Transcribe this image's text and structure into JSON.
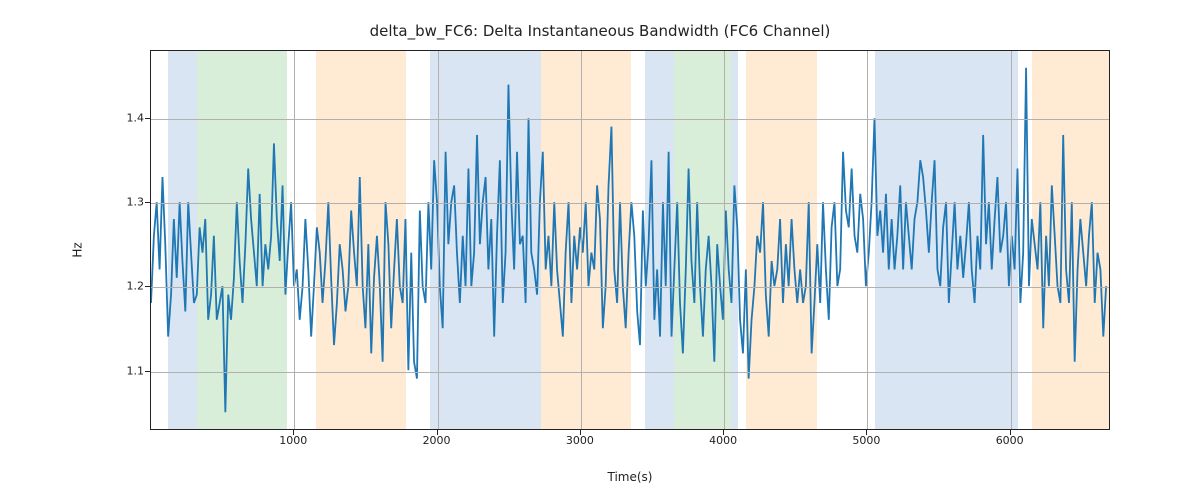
{
  "chart_data": {
    "type": "line",
    "title": "delta_bw_FC6: Delta Instantaneous Bandwidth (FC6 Channel)",
    "xlabel": "Time(s)",
    "ylabel": "Hz",
    "xlim": [
      0,
      6700
    ],
    "ylim": [
      1.03,
      1.48
    ],
    "xticks": [
      1000,
      2000,
      3000,
      4000,
      5000,
      6000
    ],
    "yticks": [
      1.1,
      1.2,
      1.3,
      1.4
    ],
    "bands": [
      {
        "x0": 120,
        "x1": 320,
        "color": "#6699cc"
      },
      {
        "x0": 320,
        "x1": 950,
        "color": "#66bb66"
      },
      {
        "x0": 1150,
        "x1": 1780,
        "color": "#ffaa55"
      },
      {
        "x0": 1950,
        "x1": 2100,
        "color": "#6699cc"
      },
      {
        "x0": 2100,
        "x1": 2720,
        "color": "#6699cc"
      },
      {
        "x0": 2720,
        "x1": 3350,
        "color": "#ffaa55"
      },
      {
        "x0": 3450,
        "x1": 3650,
        "color": "#6699cc"
      },
      {
        "x0": 3650,
        "x1": 4050,
        "color": "#66bb66"
      },
      {
        "x0": 4050,
        "x1": 4100,
        "color": "#6699cc"
      },
      {
        "x0": 4150,
        "x1": 4650,
        "color": "#ffaa55"
      },
      {
        "x0": 5050,
        "x1": 6050,
        "color": "#6699cc"
      },
      {
        "x0": 6150,
        "x1": 6700,
        "color": "#ffaa55"
      }
    ],
    "series": [
      {
        "name": "delta_bw_FC6",
        "x_step": 20,
        "x_start": 0,
        "values": [
          1.18,
          1.26,
          1.3,
          1.22,
          1.33,
          1.25,
          1.14,
          1.19,
          1.28,
          1.21,
          1.3,
          1.23,
          1.17,
          1.3,
          1.24,
          1.18,
          1.19,
          1.27,
          1.24,
          1.28,
          1.16,
          1.19,
          1.26,
          1.16,
          1.18,
          1.2,
          1.05,
          1.19,
          1.16,
          1.21,
          1.3,
          1.23,
          1.18,
          1.25,
          1.34,
          1.28,
          1.24,
          1.2,
          1.31,
          1.2,
          1.25,
          1.22,
          1.26,
          1.37,
          1.28,
          1.23,
          1.32,
          1.19,
          1.25,
          1.3,
          1.2,
          1.22,
          1.16,
          1.2,
          1.28,
          1.22,
          1.14,
          1.2,
          1.27,
          1.24,
          1.18,
          1.23,
          1.3,
          1.21,
          1.13,
          1.18,
          1.25,
          1.22,
          1.17,
          1.2,
          1.29,
          1.24,
          1.2,
          1.33,
          1.2,
          1.15,
          1.25,
          1.12,
          1.21,
          1.26,
          1.2,
          1.11,
          1.3,
          1.25,
          1.15,
          1.22,
          1.28,
          1.2,
          1.18,
          1.28,
          1.1,
          1.24,
          1.11,
          1.09,
          1.29,
          1.2,
          1.18,
          1.3,
          1.22,
          1.35,
          1.3,
          1.2,
          1.15,
          1.36,
          1.25,
          1.3,
          1.32,
          1.24,
          1.18,
          1.26,
          1.2,
          1.34,
          1.2,
          1.24,
          1.38,
          1.25,
          1.3,
          1.33,
          1.22,
          1.28,
          1.14,
          1.26,
          1.35,
          1.18,
          1.24,
          1.44,
          1.3,
          1.22,
          1.36,
          1.25,
          1.26,
          1.18,
          1.4,
          1.24,
          1.22,
          1.19,
          1.3,
          1.36,
          1.22,
          1.26,
          1.2,
          1.3,
          1.22,
          1.18,
          1.14,
          1.24,
          1.3,
          1.18,
          1.26,
          1.22,
          1.27,
          1.24,
          1.3,
          1.2,
          1.24,
          1.22,
          1.32,
          1.28,
          1.15,
          1.2,
          1.32,
          1.39,
          1.22,
          1.18,
          1.3,
          1.2,
          1.15,
          1.24,
          1.3,
          1.26,
          1.17,
          1.13,
          1.29,
          1.2,
          1.25,
          1.35,
          1.16,
          1.22,
          1.14,
          1.3,
          1.2,
          1.36,
          1.14,
          1.22,
          1.3,
          1.18,
          1.12,
          1.22,
          1.34,
          1.23,
          1.18,
          1.3,
          1.2,
          1.14,
          1.22,
          1.26,
          1.2,
          1.11,
          1.25,
          1.2,
          1.16,
          1.29,
          1.22,
          1.18,
          1.32,
          1.27,
          1.16,
          1.12,
          1.22,
          1.09,
          1.16,
          1.2,
          1.26,
          1.24,
          1.3,
          1.19,
          1.14,
          1.23,
          1.2,
          1.22,
          1.28,
          1.18,
          1.25,
          1.2,
          1.28,
          1.22,
          1.18,
          1.22,
          1.18,
          1.2,
          1.3,
          1.12,
          1.18,
          1.25,
          1.18,
          1.3,
          1.22,
          1.16,
          1.27,
          1.3,
          1.2,
          1.22,
          1.36,
          1.29,
          1.27,
          1.34,
          1.26,
          1.24,
          1.31,
          1.28,
          1.2,
          1.24,
          1.3,
          1.4,
          1.26,
          1.29,
          1.24,
          1.31,
          1.22,
          1.28,
          1.22,
          1.26,
          1.32,
          1.22,
          1.3,
          1.26,
          1.22,
          1.28,
          1.3,
          1.35,
          1.33,
          1.29,
          1.24,
          1.3,
          1.35,
          1.22,
          1.2,
          1.27,
          1.3,
          1.18,
          1.24,
          1.3,
          1.22,
          1.26,
          1.21,
          1.25,
          1.3,
          1.22,
          1.18,
          1.26,
          1.22,
          1.38,
          1.25,
          1.3,
          1.22,
          1.28,
          1.33,
          1.24,
          1.26,
          1.3,
          1.2,
          1.26,
          1.22,
          1.34,
          1.18,
          1.24,
          1.46,
          1.2,
          1.28,
          1.25,
          1.22,
          1.3,
          1.15,
          1.26,
          1.2,
          1.32,
          1.26,
          1.2,
          1.18,
          1.38,
          1.22,
          1.18,
          1.3,
          1.11,
          1.22,
          1.28,
          1.24,
          1.2,
          1.26,
          1.3,
          1.18,
          1.24,
          1.22,
          1.14,
          1.2
        ]
      }
    ]
  }
}
